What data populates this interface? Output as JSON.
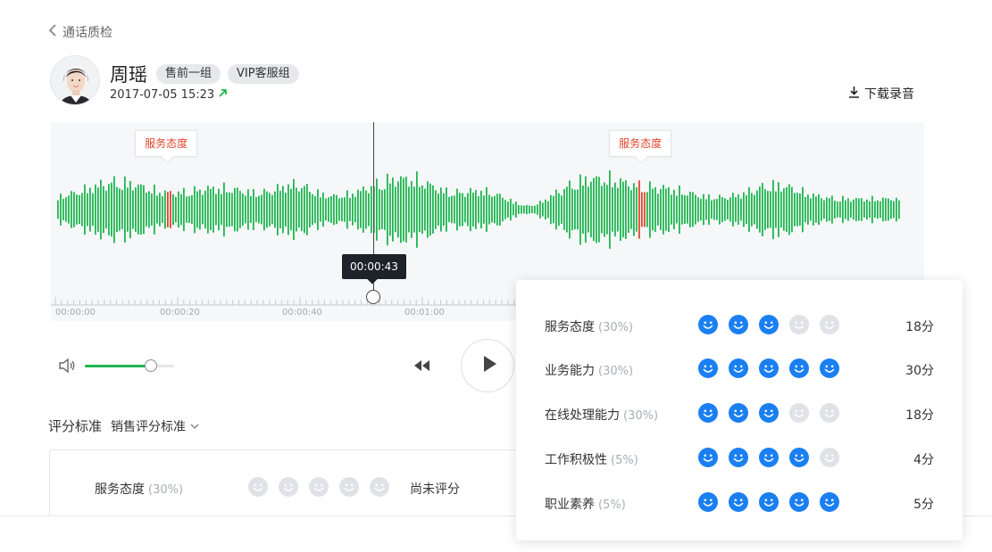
{
  "nav": {
    "back_label": "通话质检"
  },
  "agent": {
    "name": "周瑶",
    "tags": [
      "售前一组",
      "VIP客服组"
    ],
    "datetime": "2017-07-05 15:23"
  },
  "actions": {
    "download_label": "下载录音"
  },
  "player": {
    "markers": [
      {
        "label": "服务态度",
        "position": 0.131
      },
      {
        "label": "服务态度",
        "position": 0.674
      }
    ],
    "current_time": "00:00:43",
    "playhead_position": 0.369,
    "timeline_labels": [
      "00:00:00",
      "00:00:20",
      "00:00:40",
      "00:01:00"
    ],
    "volume": 0.74
  },
  "criteria": {
    "label": "评分标准",
    "selected": "销售评分标准"
  },
  "score_card": {
    "items": [
      {
        "label": "服务态度",
        "weight": "(30%)",
        "rating": 0,
        "status": "尚未评分"
      }
    ]
  },
  "popover": {
    "rows": [
      {
        "label": "服务态度",
        "weight": "(30%)",
        "rating": 3,
        "score": "18分"
      },
      {
        "label": "业务能力",
        "weight": "(30%)",
        "rating": 5,
        "score": "30分"
      },
      {
        "label": "在线处理能力",
        "weight": "(30%)",
        "rating": 3,
        "score": "18分"
      },
      {
        "label": "工作积极性",
        "weight": "(5%)",
        "rating": 4,
        "score": "4分"
      },
      {
        "label": "职业素养",
        "weight": "(5%)",
        "rating": 5,
        "score": "5分"
      }
    ]
  },
  "colors": {
    "wave": "#1fb650",
    "wave_highlight": "#e2452c",
    "face_active": "#1a7ff2",
    "face_inactive": "#dfe2e6",
    "marker_text": "#e2452c"
  },
  "icons": [
    "chevron-left-icon",
    "arrow-up-right-icon",
    "download-icon",
    "volume-icon",
    "rewind-icon",
    "play-icon",
    "chevron-down-icon",
    "smiley-face-icon"
  ]
}
